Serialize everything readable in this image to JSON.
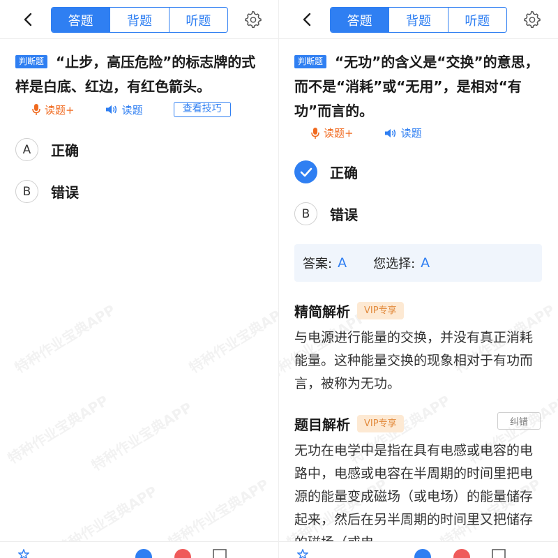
{
  "tabs": [
    "答题",
    "背题",
    "听题"
  ],
  "left": {
    "question": {
      "tag": "判断题",
      "text": "“止步，高压危险”的标志牌的式样是白底、红边，有红色箭头。"
    },
    "tools": {
      "read_plus": "读题+",
      "read": "读题",
      "tips": "查看技巧"
    },
    "options": [
      {
        "letter": "A",
        "text": "正确"
      },
      {
        "letter": "B",
        "text": "错误"
      }
    ]
  },
  "right": {
    "question": {
      "tag": "判断题",
      "text": "“无功”的含义是“交换”的意思，而不是“消耗”或“无用”，是相对“有功”而言的。"
    },
    "tools": {
      "read_plus": "读题+",
      "read": "读题"
    },
    "options": [
      {
        "letter": "A",
        "text": "正确",
        "selected": true
      },
      {
        "letter": "B",
        "text": "错误"
      }
    ],
    "answer_label": "答案:",
    "answer_value": "A",
    "choice_label": "您选择:",
    "choice_value": "A",
    "brief": {
      "title": "精简解析",
      "vip": "VIP专享",
      "text": "与电源进行能量的交换，并没有真正消耗能量。这种能量交换的现象相对于有功而言，被称为无功。"
    },
    "detail": {
      "title": "题目解析",
      "vip": "VIP专享",
      "report": "纠错",
      "text": "无功在电学中是指在具有电感或电容的电路中，电感或电容在半周期的时间里把电源的能量变成磁场（或电场）的能量储存起来，然后在另半周期的时间里又把储存的磁场（或电"
    }
  },
  "watermark": "特种作业宝典APP",
  "colors": {
    "accent": "#2f7ff2",
    "orange": "#f06a1f",
    "vip_bg": "#fde9d3",
    "vip_text": "#e28a3c"
  }
}
